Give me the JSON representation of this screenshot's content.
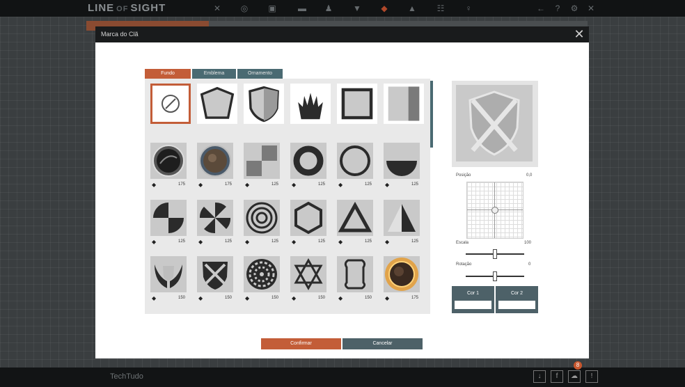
{
  "app": {
    "logo_left": "LINE",
    "logo_mid": "OF",
    "logo_right": "SIGHT",
    "watermark": "TechTudo",
    "notification_count": "8"
  },
  "dialog": {
    "title": "Marca do Clã",
    "tabs": [
      "Fundo",
      "Emblema",
      "Ornamento"
    ],
    "active_tab": "Fundo",
    "confirm_label": "Confirmar",
    "cancel_label": "Cancelar"
  },
  "emblems": [
    {
      "shape": "none",
      "price": ""
    },
    {
      "shape": "pentagon",
      "price": ""
    },
    {
      "shape": "shield",
      "price": ""
    },
    {
      "shape": "wings-crest",
      "price": ""
    },
    {
      "shape": "square",
      "price": ""
    },
    {
      "shape": "half-rect",
      "price": ""
    },
    {
      "shape": "dark-orb",
      "price": "175"
    },
    {
      "shape": "bronze-orb",
      "price": "175"
    },
    {
      "shape": "checker",
      "price": "125"
    },
    {
      "shape": "thick-ring",
      "price": "125"
    },
    {
      "shape": "thin-ring",
      "price": "125"
    },
    {
      "shape": "half-circle",
      "price": "125"
    },
    {
      "shape": "quarter-circle",
      "price": "125"
    },
    {
      "shape": "pinwheel",
      "price": "125"
    },
    {
      "shape": "target",
      "price": "125"
    },
    {
      "shape": "hexagon",
      "price": "125"
    },
    {
      "shape": "triangle",
      "price": "125"
    },
    {
      "shape": "half-triangle",
      "price": "125"
    },
    {
      "shape": "wings",
      "price": "150"
    },
    {
      "shape": "cross-shield",
      "price": "150"
    },
    {
      "shape": "mandala",
      "price": "150"
    },
    {
      "shape": "hexagram",
      "price": "150"
    },
    {
      "shape": "plaque",
      "price": "150"
    },
    {
      "shape": "sun-orb",
      "price": "175"
    }
  ],
  "controls": {
    "position_label": "Posição",
    "position_value": "0,0",
    "scale_label": "Escala",
    "scale_value": "100",
    "scale_level": 0.5,
    "rotation_label": "Rotação",
    "rotation_value": "0",
    "rotation_level": 0.5,
    "color1_label": "Cor 1",
    "color2_label": "Cor 2"
  },
  "colors": {
    "accent": "#c35d38",
    "secondary": "#4d6168",
    "tab_inactive": "#4a6a72"
  }
}
